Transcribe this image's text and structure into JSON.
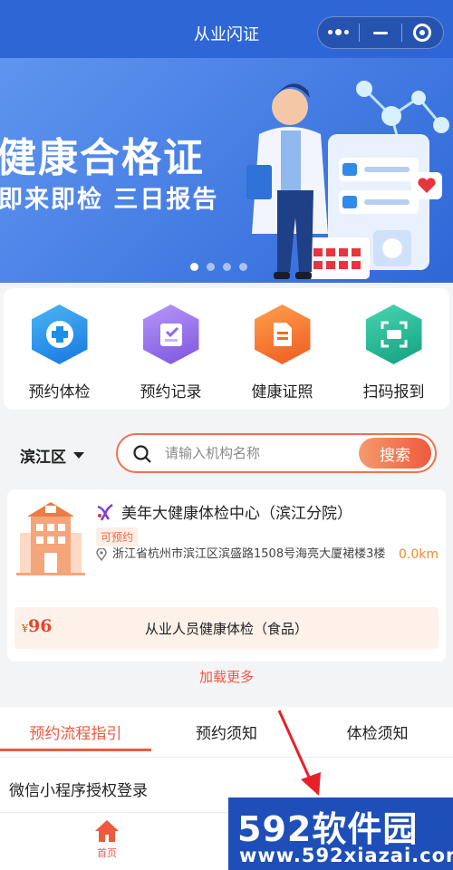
{
  "header": {
    "title": "从业闪证"
  },
  "banner": {
    "title": "健康合格证",
    "subtitle": "即来即检 三日报告",
    "pages": 4,
    "active_page": 1
  },
  "quick_menu": [
    {
      "label": "预约体检",
      "icon": "medical-cross-icon",
      "color": "#1e8ee6"
    },
    {
      "label": "预约记录",
      "icon": "record-icon",
      "color": "#8f6ae8"
    },
    {
      "label": "健康证照",
      "icon": "certificate-icon",
      "color": "#f26a24"
    },
    {
      "label": "扫码报到",
      "icon": "scan-icon",
      "color": "#1fae8e"
    }
  ],
  "search": {
    "district": "滨江区",
    "placeholder": "请输入机构名称",
    "button": "搜索"
  },
  "institution": {
    "name": "美年大健康体检中心（滨江分院）",
    "status": "可预约",
    "address": "浙江省杭州市滨江区滨盛路1508号海亮大厦裙楼3楼",
    "distance": "0.0km",
    "currency": "¥",
    "price": "96",
    "package": "从业人员健康体检（食品）"
  },
  "load_more": "加载更多",
  "tabs": [
    {
      "label": "预约流程指引",
      "active": true
    },
    {
      "label": "预约须知",
      "active": false
    },
    {
      "label": "体检须知",
      "active": false
    }
  ],
  "guide": {
    "title": "微信小程序授权登录"
  },
  "bottom_nav": {
    "home": "首页"
  },
  "watermark": {
    "brand": "592软件园",
    "url": "www.592xiazai.com"
  },
  "colors": {
    "primary": "#2f66d6",
    "accent": "#ee5a3e"
  }
}
